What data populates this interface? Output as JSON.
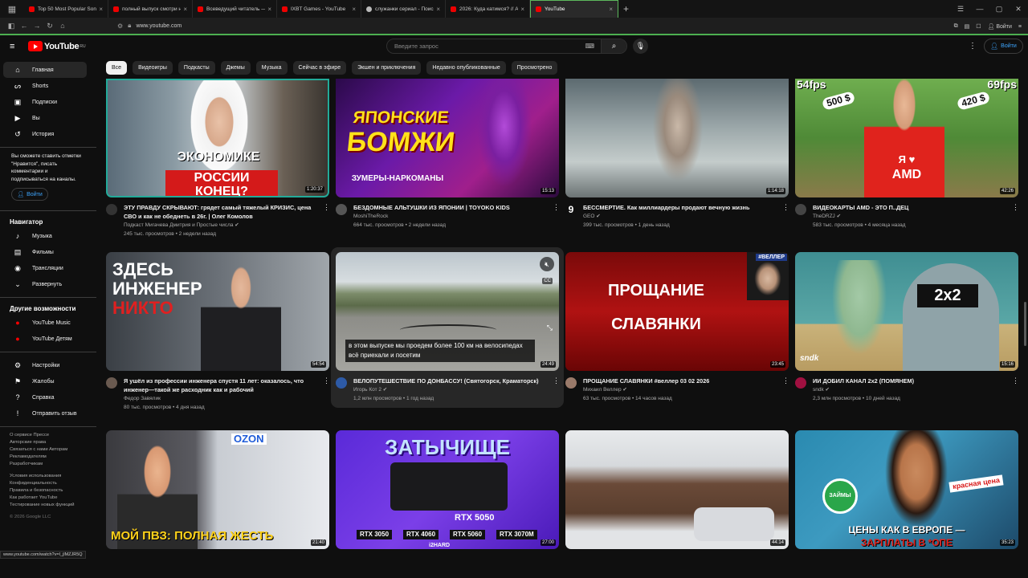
{
  "browser": {
    "tabs": [
      {
        "title": "Top 50 Most Popular Songs by",
        "icon": "youtube-icon"
      },
      {
        "title": "полный выпуск смотри на",
        "icon": "youtube-icon"
      },
      {
        "title": "Всеведущий читатель — F",
        "icon": "youtube-icon"
      },
      {
        "title": "IXBT Games - YouTube",
        "icon": "youtube-icon"
      },
      {
        "title": "служанки сериал - Поиск в Go",
        "icon": "google-icon"
      },
      {
        "title": "2026: Куда катимся? // Ант",
        "icon": "youtube-icon"
      },
      {
        "title": "YouTube",
        "icon": "youtube-icon",
        "active": true
      }
    ],
    "address": "www.youtube.com",
    "signin_label": "Войти",
    "status_url": "www.youtube.com/watch?v=I_jlMZJR5Q"
  },
  "header": {
    "logo_text": "YouTube",
    "logo_region": "RU",
    "search_placeholder": "Введите запрос",
    "signin_label": "Войти"
  },
  "sidebar": {
    "main": [
      {
        "label": "Главная",
        "icon": "home-icon",
        "active": true
      },
      {
        "label": "Shorts",
        "icon": "shorts-icon"
      },
      {
        "label": "Подписки",
        "icon": "subscriptions-icon"
      },
      {
        "label": "Вы",
        "icon": "you-icon"
      },
      {
        "label": "История",
        "icon": "history-icon"
      }
    ],
    "signin_note": "Вы сможете ставить отметки \"Нравится\", писать комментарии и подписываться на каналы.",
    "signin_label": "Войти",
    "navigator_title": "Навигатор",
    "navigator": [
      {
        "label": "Музыка",
        "icon": "music-icon"
      },
      {
        "label": "Фильмы",
        "icon": "film-icon"
      },
      {
        "label": "Трансляции",
        "icon": "live-icon"
      },
      {
        "label": "Развернуть",
        "icon": "chevron-down-icon"
      }
    ],
    "more_title": "Другие возможности",
    "more": [
      {
        "label": "YouTube Music",
        "icon": "youtube-music-icon"
      },
      {
        "label": "YouTube Детям",
        "icon": "youtube-kids-icon"
      }
    ],
    "settings": [
      {
        "label": "Настройки",
        "icon": "gear-icon"
      },
      {
        "label": "Жалобы",
        "icon": "flag-icon"
      },
      {
        "label": "Справка",
        "icon": "help-icon"
      },
      {
        "label": "Отправить отзыв",
        "icon": "feedback-icon"
      }
    ],
    "footer1": [
      "О сервисе  Прессе",
      "Авторские права",
      "Связаться с нами  Авторам",
      "Рекламодателям",
      "Разработчикам"
    ],
    "footer2": [
      "Условия использования",
      "Конфиденциальность",
      "Правила и безопасность",
      "Как работает YouTube",
      "Тестирование новых функций"
    ],
    "copyright": "© 2026 Google LLC"
  },
  "chips": [
    "Все",
    "Видеоигры",
    "Подкасты",
    "Джемы",
    "Музыка",
    "Сейчас в эфире",
    "Экшен и приключения",
    "Недавно опубликованные",
    "Просмотрено"
  ],
  "videos": [
    {
      "title": "ЭТУ ПРАВДУ СКРЫВАЮТ: грядет самый тяжелый КРИЗИС, цена СВО и как не обеднеть в 26г. | Олег Комолов",
      "channel": "Подкаст Мигачева Дмитрия и Простые числа ✔",
      "stats": "245 тыс. просмотров • 2 недели назад",
      "duration": "1:20:37",
      "thumb_text": [
        "ЭКОНОМИКЕ",
        "РОССИИ КОНЕЦ?"
      ]
    },
    {
      "title": "БЕЗДОМНЫЕ АЛЬТУШКИ ИЗ ЯПОНИИ | TOYOKO KIDS",
      "channel": "MoshiTheRock",
      "stats": "664 тыс. просмотров • 2 недели назад",
      "duration": "15:13",
      "thumb_text": [
        "ЯПОНСКИЕ",
        "БОМЖИ",
        "ЗУМЕРЫ-НАРКОМАНЫ"
      ]
    },
    {
      "title": "БЕССМЕРТИЕ. Как миллиардеры продают вечную жизнь",
      "channel": "GEO ✔",
      "stats": "399 тыс. просмотров • 1 день назад",
      "duration": "1:14:18",
      "thumb_text": []
    },
    {
      "title": "ВИДЕОКАРТЫ AMD - ЭТО П..ДЕЦ",
      "channel": "TheDRZJ ✔",
      "stats": "583 тыс. просмотров • 4 месяца назад",
      "duration": "42:26",
      "thumb_text": [
        "54fps",
        "500 $",
        "69fps",
        "420 $",
        "Я ♥",
        "AMD"
      ]
    },
    {
      "title": "Я ушёл из профессии инженера спустя 11 лет: оказалось, что инженер—такой же расходник как и рабочий",
      "channel": "Федор Завялик",
      "stats": "80 тыс. просмотров • 4 дня назад",
      "duration": "54:54",
      "thumb_text": [
        "ЗДЕСЬ",
        "ИНЖЕНЕР",
        "НИКТО"
      ]
    },
    {
      "title": "ВЕЛОПУТЕШЕСТВИЕ ПО ДОНБАССУ! (Святогорск, Краматорск)",
      "channel": "Игорь Кот 2 ✔",
      "stats": "1,2 млн просмотров • 1 год назад",
      "duration": "24:49",
      "caption": "в этом выпуске мы проедем более 100 км на велосипедах всё приехали и посетим"
    },
    {
      "title": "ПРОЩАНИЕ СЛАВЯНКИ  #веллер 03 02 2026",
      "channel": "Михаил Веллер ✔",
      "stats": "63 тыс. просмотров • 14 часов назад",
      "duration": "23:45",
      "thumb_text": [
        "#ВЕЛЛЕР",
        "ПРОЩАНИЕ",
        "СЛАВЯНКИ"
      ]
    },
    {
      "title": "ИИ ДОБИЛ КАНАЛ 2x2 (ПОМЯНЕМ)",
      "channel": "sndk ✔",
      "stats": "2,3 млн просмотров • 10 дней назад",
      "duration": "15:16",
      "thumb_text": [
        "2x2",
        "sndk"
      ]
    },
    {
      "title": "",
      "channel": "",
      "stats": "",
      "duration": "21:40",
      "thumb_text": [
        "OZON",
        "МОЙ ПВЗ: ПОЛНАЯ ЖЕСТЬ"
      ]
    },
    {
      "title": "",
      "channel": "",
      "stats": "",
      "duration": "27:00",
      "thumb_text": [
        "ЗАТЫЧИЩЕ",
        "RTX 5050",
        "RTX 3050",
        "RTX 4060",
        "RTX 5060",
        "RTX 3070M",
        "i2HARD"
      ]
    },
    {
      "title": "",
      "channel": "",
      "stats": "",
      "duration": "44:14",
      "thumb_text": []
    },
    {
      "title": "",
      "channel": "",
      "stats": "",
      "duration": "35:23",
      "thumb_text": [
        "ЦЕНЫ КАК В ЕВРОПЕ —",
        "ЗАРПЛАТЫ В *ОПЕ",
        "красная цена",
        "ЗАЙМЫ"
      ]
    }
  ]
}
